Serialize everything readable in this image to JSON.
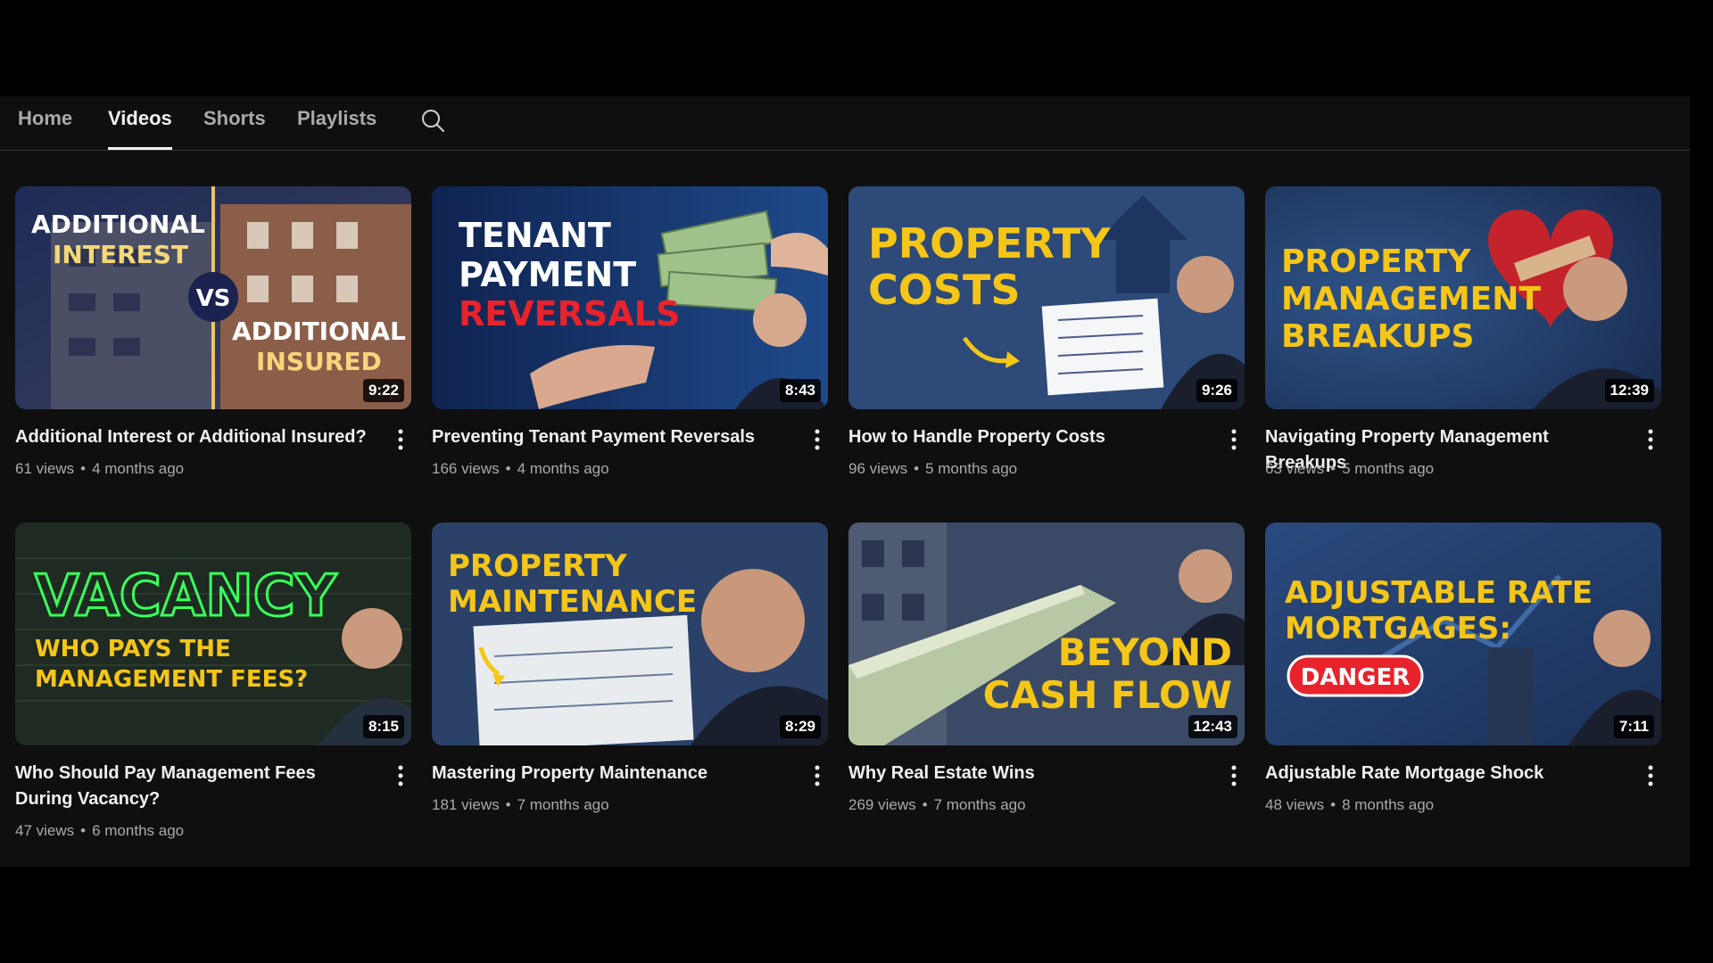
{
  "tabs": [
    {
      "label": "Home"
    },
    {
      "label": "Videos"
    },
    {
      "label": "Shorts"
    },
    {
      "label": "Playlists"
    }
  ],
  "active_tab": "Videos",
  "search_icon": "search-icon",
  "menu_icon": "more-vert-icon",
  "videos": [
    {
      "title": "Additional Interest or Additional Insured?",
      "views": "61 views",
      "age": "4 months ago",
      "duration": "9:22",
      "thumb_text": [
        "ADDITIONAL",
        "INTEREST",
        "VS",
        "ADDITIONAL",
        "INSURED"
      ]
    },
    {
      "title": "Preventing Tenant Payment Reversals",
      "views": "166 views",
      "age": "4 months ago",
      "duration": "8:43",
      "thumb_text": [
        "TENANT",
        "PAYMENT",
        "REVERSALS"
      ]
    },
    {
      "title": "How to Handle Property Costs",
      "views": "96 views",
      "age": "5 months ago",
      "duration": "9:26",
      "thumb_text": [
        "PROPERTY",
        "COSTS"
      ]
    },
    {
      "title": "Navigating Property Management Breakups",
      "views": "63 views",
      "age": "5 months ago",
      "duration": "12:39",
      "thumb_text": [
        "PROPERTY",
        "MANAGEMENT",
        "BREAKUPS"
      ]
    },
    {
      "title": "Who Should Pay Management Fees During Vacancy?",
      "views": "47 views",
      "age": "6 months ago",
      "duration": "8:15",
      "thumb_text": [
        "VACANCY",
        "WHO PAYS THE",
        "MANAGEMENT FEES?"
      ]
    },
    {
      "title": "Mastering Property Maintenance",
      "views": "181 views",
      "age": "7 months ago",
      "duration": "8:29",
      "thumb_text": [
        "PROPERTY",
        "MAINTENANCE"
      ]
    },
    {
      "title": "Why Real Estate Wins",
      "views": "269 views",
      "age": "7 months ago",
      "duration": "12:43",
      "thumb_text": [
        "BEYOND",
        "CASH FLOW"
      ]
    },
    {
      "title": "Adjustable Rate Mortgage Shock",
      "views": "48 views",
      "age": "8 months ago",
      "duration": "7:11",
      "thumb_text": [
        "ADJUSTABLE RATE",
        "MORTGAGES:",
        "DANGER"
      ]
    }
  ],
  "colors": {
    "page_bg": "#0f0f0f",
    "text_primary": "#f1f1f1",
    "text_secondary": "#aaaaaa",
    "thumb_yellow": "#f5c518",
    "thumb_red": "#e8232b",
    "thumb_neon": "#39ff5a"
  }
}
